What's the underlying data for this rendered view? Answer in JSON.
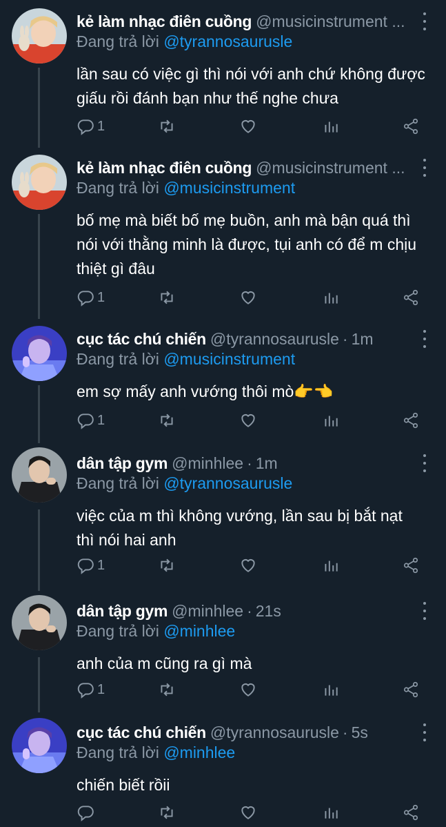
{
  "reply_prefix": "Đang trả lời",
  "colors": {
    "background": "#15202b",
    "accent": "#1d9bf0",
    "muted": "#8b98a5",
    "line": "#38444d"
  },
  "tweets": [
    {
      "name": "kẻ làm nhạc điên cuồng",
      "handle": "@musicinstrument ...",
      "time": "",
      "reply_to": "@tyrannosaurusle",
      "text_lines": [
        "lần sau có việc gì thì nói với anh chứ không được",
        "giấu rồi đánh bạn như thế nghe chưa"
      ],
      "reply_count": "1",
      "avatar": "blond-boy-avatar"
    },
    {
      "name": "kẻ làm nhạc điên cuồng",
      "handle": "@musicinstrument ...",
      "time": "",
      "reply_to": "@musicinstrument",
      "text_lines": [
        "bố mẹ mà biết bố mẹ buồn, anh mà bận quá thì",
        "nói với thằng minh là được, tụi anh có để m chịu",
        "thiệt gì đâu"
      ],
      "reply_count": "1",
      "avatar": "blond-boy-avatar"
    },
    {
      "name": "cục tác chú chiến",
      "handle": "@tyrannosaurusle",
      "time": "1m",
      "reply_to": "@musicinstrument",
      "text_lines": [
        "em sợ mấy anh vướng thôi mò👉👈"
      ],
      "reply_count": "1",
      "avatar": "purple-boy-avatar"
    },
    {
      "name": "dân tập gym",
      "handle": "@minhlee",
      "time": "1m",
      "reply_to": "@tyrannosaurusle",
      "text_lines": [
        "việc của m thì không vướng, lần sau bị bắt nạt",
        "thì nói hai anh"
      ],
      "reply_count": "1",
      "avatar": "dark-man-avatar"
    },
    {
      "name": "dân tập gym",
      "handle": "@minhlee",
      "time": "21s",
      "reply_to": "@minhlee",
      "text_lines": [
        "anh của m cũng ra gì mà"
      ],
      "reply_count": "1",
      "avatar": "dark-man-avatar"
    },
    {
      "name": "cục tác chú chiến",
      "handle": "@tyrannosaurusle",
      "time": "5s",
      "reply_to": "@minhlee",
      "text_lines": [
        "chiến biết rồii"
      ],
      "reply_count": "",
      "avatar": "purple-boy-avatar"
    }
  ]
}
